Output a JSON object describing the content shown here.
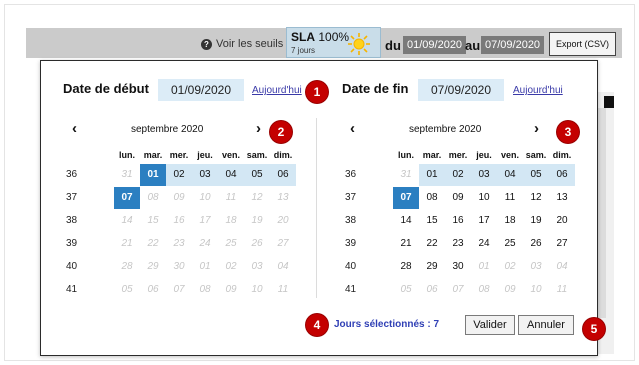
{
  "toolbar": {
    "seuils_label": "Voir les seuils",
    "sla_prefix": "SLA",
    "sla_value": "100%",
    "sla_period": "7 jours",
    "du_label": "du",
    "date_from": "01/09/2020",
    "au_label": "au",
    "date_to": "07/09/2020",
    "export_label": "Export (CSV)"
  },
  "picker": {
    "start": {
      "label": "Date de début",
      "value": "01/09/2020",
      "today_link": "Aujourd'hui"
    },
    "end": {
      "label": "Date de fin",
      "value": "07/09/2020",
      "today_link": "Aujourd'hui"
    },
    "left_month": "septembre 2020",
    "right_month": "septembre 2020",
    "day_headers": [
      "lun.",
      "mar.",
      "mer.",
      "jeu.",
      "ven.",
      "sam.",
      "dim."
    ],
    "left_weeks": [
      {
        "wk": "36",
        "days": [
          {
            "d": "31",
            "s": "dim"
          },
          {
            "d": "01",
            "s": "sel"
          },
          {
            "d": "02",
            "s": "cur"
          },
          {
            "d": "03",
            "s": "cur"
          },
          {
            "d": "04",
            "s": "cur"
          },
          {
            "d": "05",
            "s": "cur"
          },
          {
            "d": "06",
            "s": "cur"
          }
        ]
      },
      {
        "wk": "37",
        "days": [
          {
            "d": "07",
            "s": "sel"
          },
          {
            "d": "08",
            "s": "dim"
          },
          {
            "d": "09",
            "s": "dim"
          },
          {
            "d": "10",
            "s": "dim"
          },
          {
            "d": "11",
            "s": "dim"
          },
          {
            "d": "12",
            "s": "dim"
          },
          {
            "d": "13",
            "s": "dim"
          }
        ]
      },
      {
        "wk": "38",
        "days": [
          {
            "d": "14",
            "s": "dim"
          },
          {
            "d": "15",
            "s": "dim"
          },
          {
            "d": "16",
            "s": "dim"
          },
          {
            "d": "17",
            "s": "dim"
          },
          {
            "d": "18",
            "s": "dim"
          },
          {
            "d": "19",
            "s": "dim"
          },
          {
            "d": "20",
            "s": "dim"
          }
        ]
      },
      {
        "wk": "39",
        "days": [
          {
            "d": "21",
            "s": "dim"
          },
          {
            "d": "22",
            "s": "dim"
          },
          {
            "d": "23",
            "s": "dim"
          },
          {
            "d": "24",
            "s": "dim"
          },
          {
            "d": "25",
            "s": "dim"
          },
          {
            "d": "26",
            "s": "dim"
          },
          {
            "d": "27",
            "s": "dim"
          }
        ]
      },
      {
        "wk": "40",
        "days": [
          {
            "d": "28",
            "s": "dim"
          },
          {
            "d": "29",
            "s": "dim"
          },
          {
            "d": "30",
            "s": "dim"
          },
          {
            "d": "01",
            "s": "dim"
          },
          {
            "d": "02",
            "s": "dim"
          },
          {
            "d": "03",
            "s": "dim"
          },
          {
            "d": "04",
            "s": "dim"
          }
        ]
      },
      {
        "wk": "41",
        "days": [
          {
            "d": "05",
            "s": "dim"
          },
          {
            "d": "06",
            "s": "dim"
          },
          {
            "d": "07",
            "s": "dim"
          },
          {
            "d": "08",
            "s": "dim"
          },
          {
            "d": "09",
            "s": "dim"
          },
          {
            "d": "10",
            "s": "dim"
          },
          {
            "d": "11",
            "s": "dim"
          }
        ]
      }
    ],
    "right_weeks": [
      {
        "wk": "36",
        "days": [
          {
            "d": "31",
            "s": "dim"
          },
          {
            "d": "01",
            "s": "cur"
          },
          {
            "d": "02",
            "s": "cur"
          },
          {
            "d": "03",
            "s": "cur"
          },
          {
            "d": "04",
            "s": "cur"
          },
          {
            "d": "05",
            "s": "cur"
          },
          {
            "d": "06",
            "s": "cur"
          }
        ]
      },
      {
        "wk": "37",
        "days": [
          {
            "d": "07",
            "s": "sel"
          },
          {
            "d": "08",
            "s": "cur"
          },
          {
            "d": "09",
            "s": "cur"
          },
          {
            "d": "10",
            "s": "cur"
          },
          {
            "d": "11",
            "s": "cur"
          },
          {
            "d": "12",
            "s": "cur"
          },
          {
            "d": "13",
            "s": "cur"
          }
        ]
      },
      {
        "wk": "38",
        "days": [
          {
            "d": "14",
            "s": "cur"
          },
          {
            "d": "15",
            "s": "cur"
          },
          {
            "d": "16",
            "s": "cur"
          },
          {
            "d": "17",
            "s": "cur"
          },
          {
            "d": "18",
            "s": "cur"
          },
          {
            "d": "19",
            "s": "cur"
          },
          {
            "d": "20",
            "s": "cur"
          }
        ]
      },
      {
        "wk": "39",
        "days": [
          {
            "d": "21",
            "s": "cur"
          },
          {
            "d": "22",
            "s": "cur"
          },
          {
            "d": "23",
            "s": "cur"
          },
          {
            "d": "24",
            "s": "cur"
          },
          {
            "d": "25",
            "s": "cur"
          },
          {
            "d": "26",
            "s": "cur"
          },
          {
            "d": "27",
            "s": "cur"
          }
        ]
      },
      {
        "wk": "40",
        "days": [
          {
            "d": "28",
            "s": "cur"
          },
          {
            "d": "29",
            "s": "cur"
          },
          {
            "d": "30",
            "s": "cur"
          },
          {
            "d": "01",
            "s": "dim"
          },
          {
            "d": "02",
            "s": "dim"
          },
          {
            "d": "03",
            "s": "dim"
          },
          {
            "d": "04",
            "s": "dim"
          }
        ]
      },
      {
        "wk": "41",
        "days": [
          {
            "d": "05",
            "s": "dim"
          },
          {
            "d": "06",
            "s": "dim"
          },
          {
            "d": "07",
            "s": "dim"
          },
          {
            "d": "08",
            "s": "dim"
          },
          {
            "d": "09",
            "s": "dim"
          },
          {
            "d": "10",
            "s": "dim"
          },
          {
            "d": "11",
            "s": "dim"
          }
        ]
      }
    ],
    "selected_count": "Jours sélectionnés : 7",
    "validate_label": "Valider",
    "cancel_label": "Annuler"
  },
  "badges": [
    "1",
    "2",
    "3",
    "4",
    "5"
  ],
  "colors": {
    "badge": "#c40000",
    "selected": "#2b7fc1",
    "range": "#d3e7f4",
    "link": "#3a3aa8"
  }
}
